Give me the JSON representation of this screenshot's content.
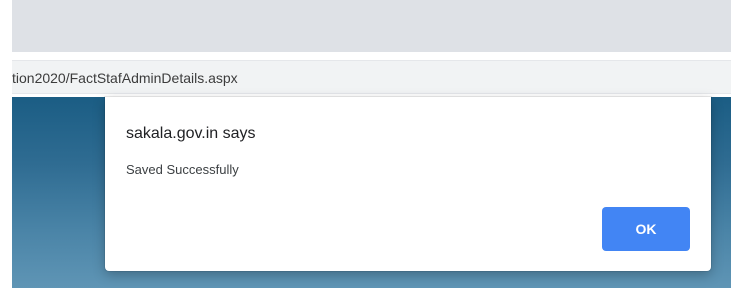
{
  "browser": {
    "address_bar_text": "tion2020/FactStafAdminDetails.aspx"
  },
  "dialog": {
    "title": "sakala.gov.in says",
    "message": "Saved Successfully",
    "ok_label": "OK"
  },
  "colors": {
    "tab_strip": "#dee1e6",
    "address_box": "#f1f3f4",
    "page_background_top": "#1b5d84",
    "page_background_bottom": "#5f95b5",
    "dialog_background": "#ffffff",
    "ok_button": "#4285f4"
  }
}
